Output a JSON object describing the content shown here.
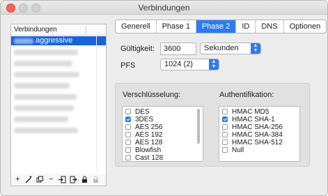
{
  "window": {
    "title": "Verbindungen"
  },
  "connections": {
    "header": "Verbindungen",
    "rows": [
      {
        "label": "aggressive",
        "selected": true
      }
    ]
  },
  "toolbar_buttons": [
    "+",
    "add-wizard",
    "duplicate",
    "−",
    "import",
    "export",
    "lock",
    "locked"
  ],
  "tabs": [
    {
      "label": "Generell",
      "active": false
    },
    {
      "label": "Phase 1",
      "active": false
    },
    {
      "label": "Phase 2",
      "active": true
    },
    {
      "label": "ID",
      "active": false
    },
    {
      "label": "DNS",
      "active": false
    },
    {
      "label": "Optionen",
      "active": false
    }
  ],
  "lifetime": {
    "label": "Gültigkeit:",
    "value": "3600",
    "unit": "Sekunden"
  },
  "pfs": {
    "label": "PFS",
    "value": "1024 (2)"
  },
  "encryption": {
    "title": "Verschlüsselung:",
    "items": [
      {
        "label": "DES",
        "checked": false
      },
      {
        "label": "3DES",
        "checked": true
      },
      {
        "label": "AES 256",
        "checked": false
      },
      {
        "label": "AES 192",
        "checked": false
      },
      {
        "label": "AES 128",
        "checked": false
      },
      {
        "label": "Blowfish",
        "checked": false
      },
      {
        "label": "Cast 128",
        "checked": false
      }
    ]
  },
  "authentication": {
    "title": "Authentifikation:",
    "items": [
      {
        "label": "HMAC MD5",
        "checked": false
      },
      {
        "label": "HMAC SHA-1",
        "checked": true
      },
      {
        "label": "HMAC SHA-256",
        "checked": false
      },
      {
        "label": "HMAC SHA-384",
        "checked": false
      },
      {
        "label": "HMAC SHA-512",
        "checked": false
      },
      {
        "label": "Null",
        "checked": false
      }
    ]
  },
  "colors": {
    "accent": "#2d7bf4",
    "selection": "#1a64d9",
    "close": "#fe5f57"
  }
}
